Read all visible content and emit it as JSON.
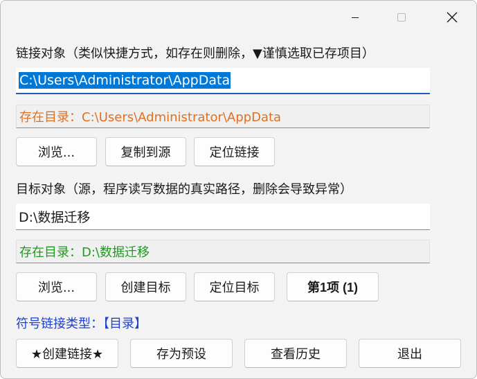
{
  "window": {
    "caption": {
      "minimize_icon": "minimize-icon",
      "maximize_icon": "maximize-icon",
      "close_icon": "close-icon",
      "close_glyph": "✕"
    }
  },
  "link_section": {
    "label": "链接对象（类似快捷方式，如存在则删除，▼谨慎选取已存项目）",
    "path_value": "C:\\Users\\Administrator\\AppData",
    "status": "存在目录：C:\\Users\\Administrator\\AppData",
    "status_color": "#e07020",
    "buttons": {
      "browse": "浏览...",
      "copy_to_source": "复制到源",
      "locate_link": "定位链接"
    }
  },
  "target_section": {
    "label": "目标对象（源，程序读写数据的真实路径，删除会导致异常）",
    "path_value": "D:\\数据迁移",
    "status": "存在目录：D:\\数据迁移",
    "status_color": "#1f9a1f",
    "buttons": {
      "browse": "浏览...",
      "create_target": "创建目标",
      "locate_target": "定位目标",
      "item_counter": "第1项 (1)"
    }
  },
  "symlink_type": {
    "text": "符号链接类型：【目录】",
    "color": "#1f3fd0"
  },
  "actions": {
    "create_link": "★创建链接★",
    "save_preset": "存为预设",
    "view_history": "查看历史",
    "exit": "退出"
  },
  "colors": {
    "selection_highlight": "#0078d7",
    "focus_underline": "#1e5fb3"
  }
}
